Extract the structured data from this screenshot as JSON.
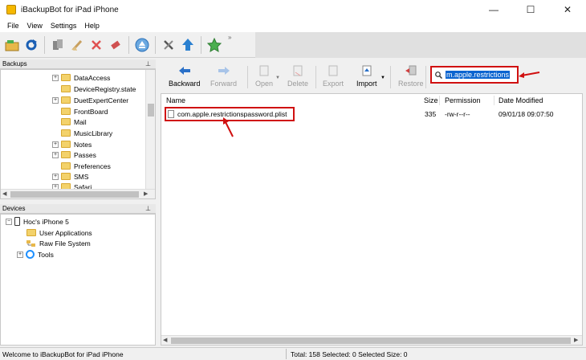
{
  "window": {
    "title": "iBackupBot for iPad iPhone",
    "minimize": "—",
    "maximize": "☐",
    "close": "✕"
  },
  "menu": [
    "File",
    "View",
    "Settings",
    "Help"
  ],
  "toolbar": {
    "more": "»"
  },
  "backups_panel": {
    "header": "Backups",
    "pin": "📌",
    "items": [
      {
        "label": "DataAccess",
        "expandable": true
      },
      {
        "label": "DeviceRegistry.state",
        "expandable": false
      },
      {
        "label": "DuetExpertCenter",
        "expandable": true
      },
      {
        "label": "FrontBoard",
        "expandable": false
      },
      {
        "label": "Mail",
        "expandable": false
      },
      {
        "label": "MusicLibrary",
        "expandable": false
      },
      {
        "label": "Notes",
        "expandable": true
      },
      {
        "label": "Passes",
        "expandable": true
      },
      {
        "label": "Preferences",
        "expandable": false
      },
      {
        "label": "SMS",
        "expandable": true
      },
      {
        "label": "Safari",
        "expandable": true
      }
    ]
  },
  "devices_panel": {
    "header": "Devices",
    "pin": "📌",
    "device_name": "Hoc's iPhone 5",
    "children": [
      "User Applications",
      "Raw File System",
      "Tools"
    ]
  },
  "right_toolbar": {
    "buttons": [
      {
        "label": "Backward",
        "enabled": true
      },
      {
        "label": "Forward",
        "enabled": false
      },
      {
        "label": "Open",
        "enabled": false
      },
      {
        "label": "Delete",
        "enabled": false
      },
      {
        "label": "Export",
        "enabled": false
      },
      {
        "label": "Import",
        "enabled": true
      },
      {
        "label": "Restore",
        "enabled": false
      }
    ]
  },
  "search": {
    "value": "m.apple.restrictions"
  },
  "file_list": {
    "columns": [
      "Name",
      "Size",
      "Permission",
      "Date Modified"
    ],
    "rows": [
      {
        "name": "com.apple.restrictionspassword.plist",
        "size": "335",
        "permission": "-rw-r--r--",
        "date": "09/01/18 09:07:50"
      }
    ]
  },
  "status": {
    "welcome": "Welcome to iBackupBot for iPad iPhone",
    "summary": "Total: 158 Selected: 0 Selected Size: 0"
  },
  "colors": {
    "annotation_red": "#d01010",
    "selection_blue": "#0a64d0"
  }
}
